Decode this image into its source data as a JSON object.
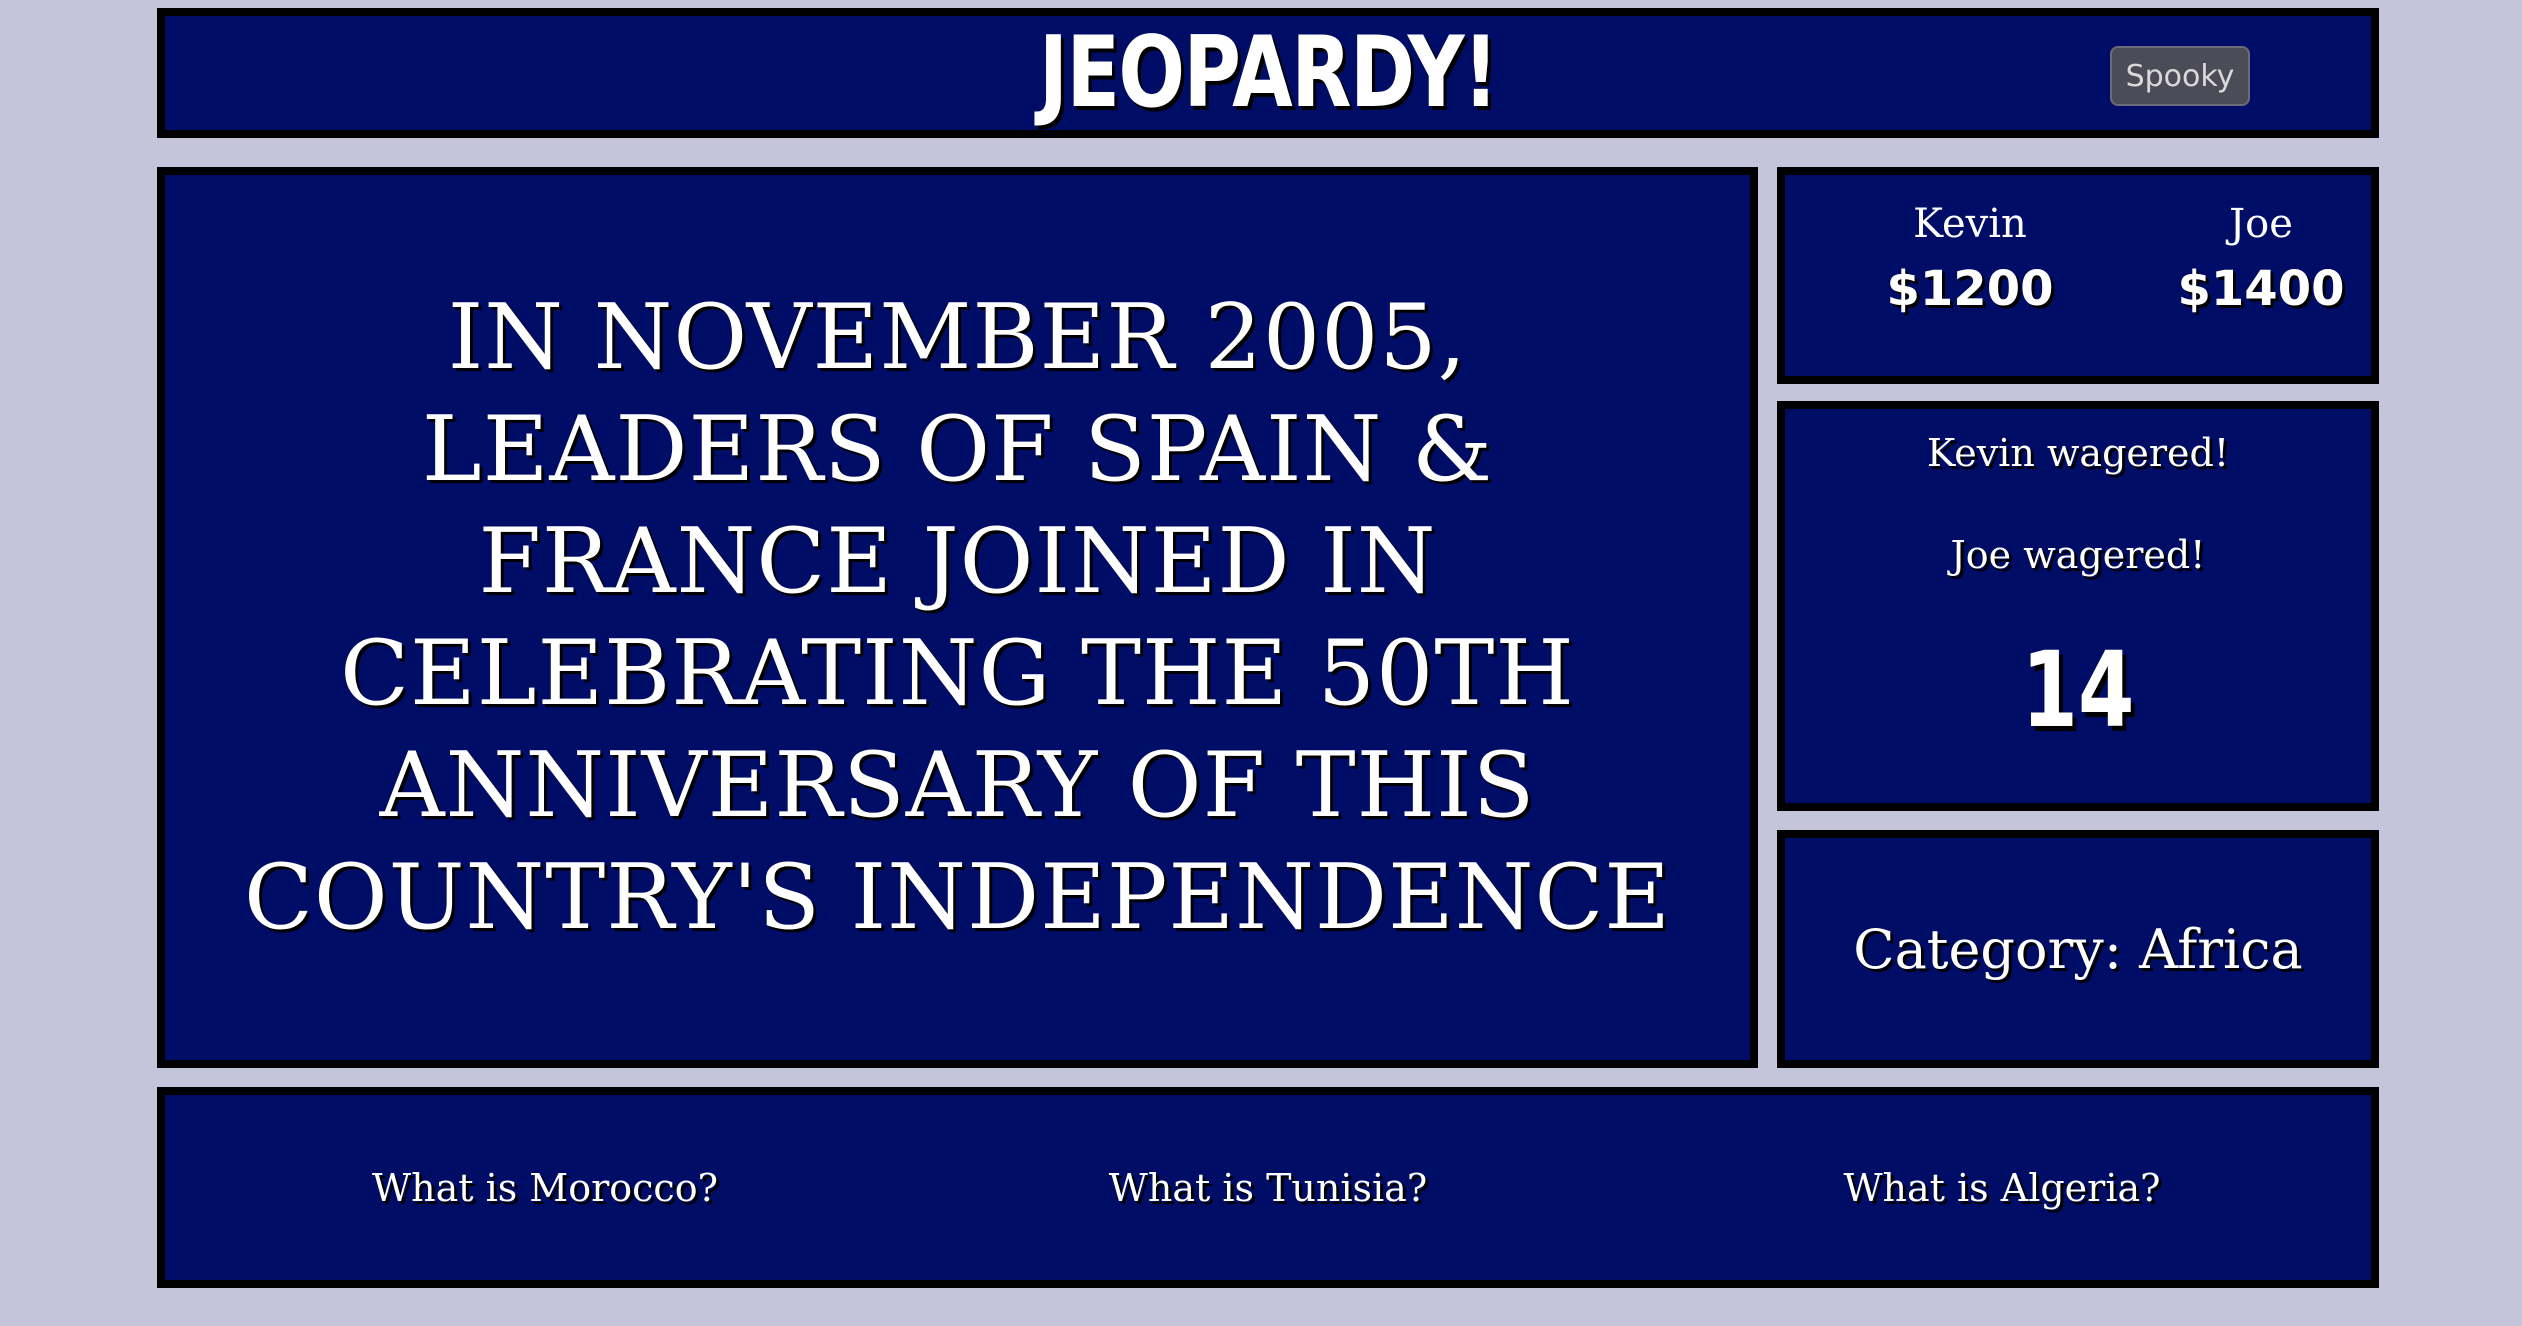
{
  "header": {
    "logo": "JEOPARDY!",
    "theme_button": "Spooky"
  },
  "clue": {
    "text": "In November 2005, leaders of Spain & France joined in celebrating the 50th anniversary of this country's independence"
  },
  "players": [
    {
      "name": "Kevin",
      "score": "$1200"
    },
    {
      "name": "Joe",
      "score": "$1400"
    }
  ],
  "status": {
    "wagers": [
      "Kevin wagered!",
      "Joe wagered!"
    ],
    "timer": "14"
  },
  "category": {
    "label": "Category: Africa"
  },
  "answers": [
    "What is Morocco?",
    "What is Tunisia?",
    "What is Algeria?"
  ],
  "colors": {
    "background": "#c4c5da",
    "panel": "#000d66",
    "border": "#000000",
    "text": "#ffffff"
  }
}
